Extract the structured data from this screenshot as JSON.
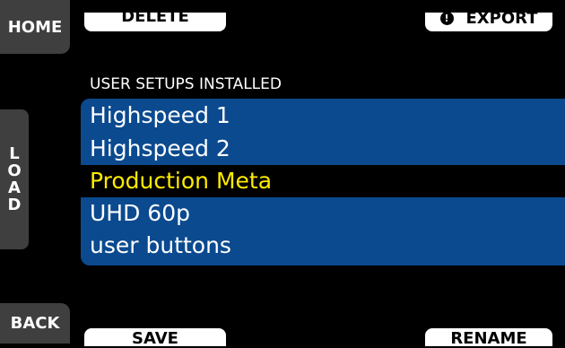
{
  "sidebar": {
    "home_label": "HOME",
    "load_letters": [
      "L",
      "O",
      "A",
      "D"
    ],
    "back_label": "BACK"
  },
  "softkeys": {
    "delete_label": "DELETE",
    "export_label": "EXPORT",
    "export_icon": "!",
    "save_label": "SAVE",
    "rename_label": "RENAME"
  },
  "main": {
    "section_label": "USER SETUPS INSTALLED",
    "setups": [
      {
        "label": "Highspeed 1",
        "selected": false
      },
      {
        "label": "Highspeed 2",
        "selected": false
      },
      {
        "label": "Production Meta",
        "selected": true
      },
      {
        "label": "UHD 60p",
        "selected": false
      },
      {
        "label": "user buttons",
        "selected": false
      }
    ]
  },
  "colors": {
    "list_background": "#0b4a8f",
    "selected_text": "#ffeb00",
    "side_button": "#3f3f3f"
  }
}
